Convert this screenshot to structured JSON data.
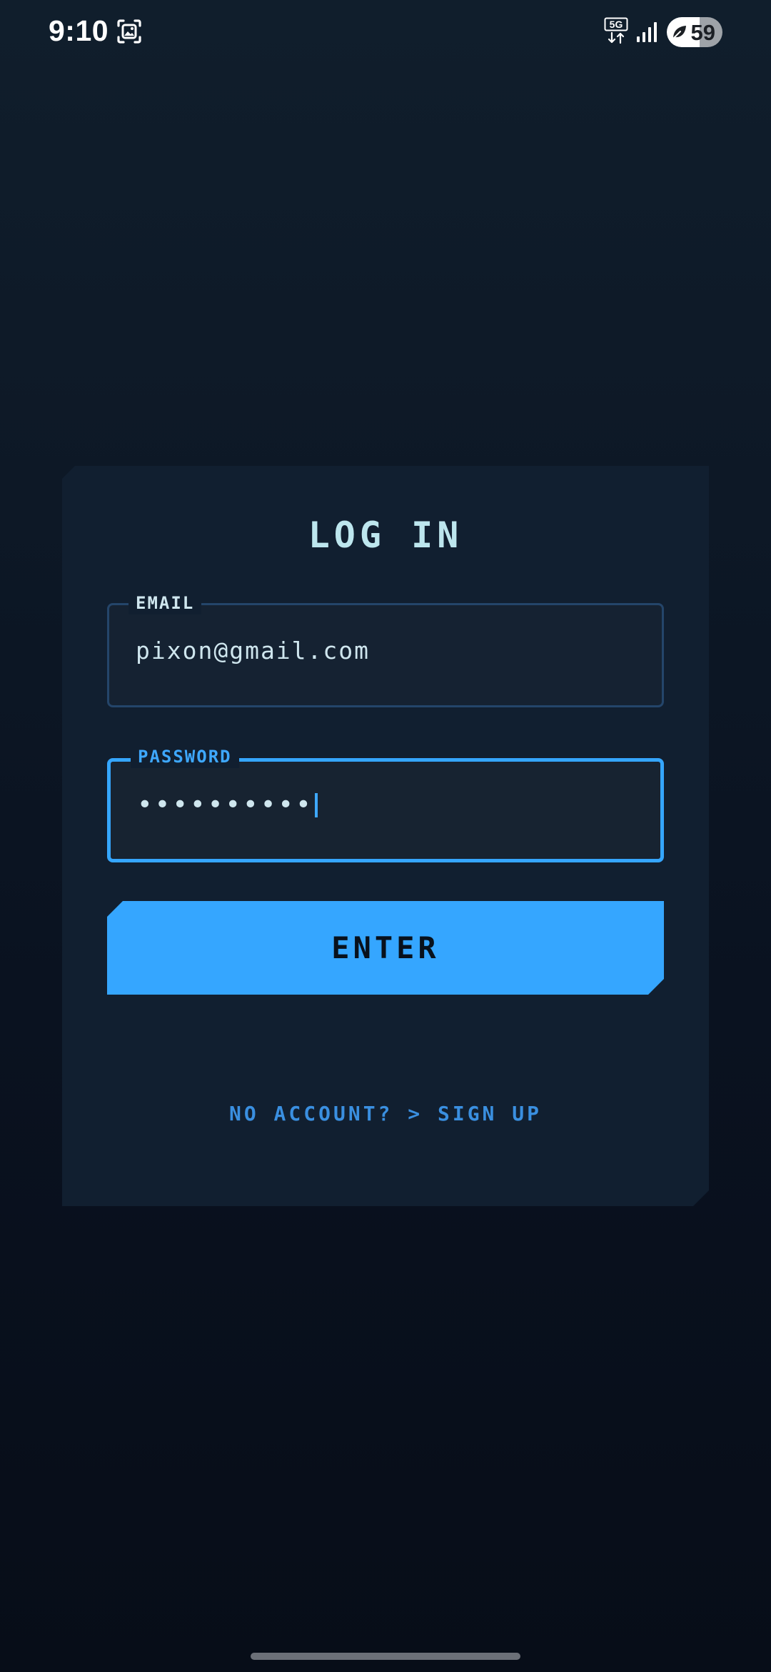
{
  "status_bar": {
    "time": "9:10",
    "network_icon": "5g-data-icon",
    "network_label": "5G",
    "signal_icon": "cellular-signal-icon",
    "battery_level": "59",
    "battery_fraction": 0.59,
    "battery_icon": "leaf-power-saver-icon"
  },
  "login": {
    "title": "LOG IN",
    "email": {
      "label": "EMAIL",
      "value": "pixon@gmail.com"
    },
    "password": {
      "label": "PASSWORD",
      "masked_value": "••••••••••",
      "focused": true
    },
    "enter_label": "ENTER",
    "signup_text": "NO ACCOUNT? > SIGN UP"
  },
  "colors": {
    "accent": "#35a6ff",
    "card_bg": "#111f30",
    "title_text": "#bde6ee",
    "link": "#3a8fe0"
  }
}
